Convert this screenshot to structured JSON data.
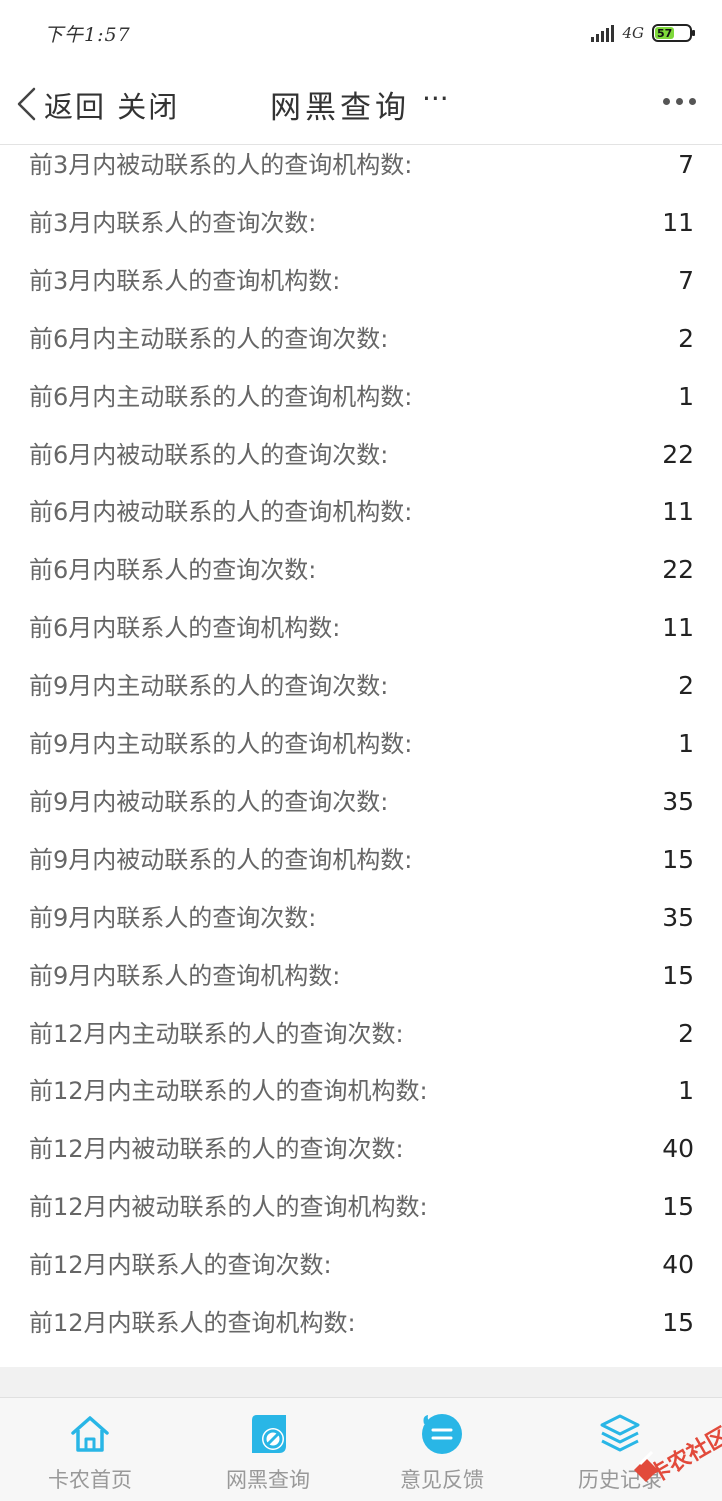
{
  "status_bar": {
    "time": "下午1:57",
    "network": "4G",
    "battery": "57"
  },
  "nav": {
    "back_label": "返回",
    "close_label": "关闭",
    "title": "网黑查询",
    "title_suffix": "···"
  },
  "rows": [
    {
      "label": "前3月内被动联系的人的查询机构数:",
      "value": "7"
    },
    {
      "label": "前3月内联系人的查询次数:",
      "value": "11"
    },
    {
      "label": "前3月内联系人的查询机构数:",
      "value": "7"
    },
    {
      "label": "前6月内主动联系的人的查询次数:",
      "value": "2"
    },
    {
      "label": "前6月内主动联系的人的查询机构数:",
      "value": "1"
    },
    {
      "label": "前6月内被动联系的人的查询次数:",
      "value": "22"
    },
    {
      "label": "前6月内被动联系的人的查询机构数:",
      "value": "11"
    },
    {
      "label": "前6月内联系人的查询次数:",
      "value": "22"
    },
    {
      "label": "前6月内联系人的查询机构数:",
      "value": "11"
    },
    {
      "label": "前9月内主动联系的人的查询次数:",
      "value": "2"
    },
    {
      "label": "前9月内主动联系的人的查询机构数:",
      "value": "1"
    },
    {
      "label": "前9月内被动联系的人的查询次数:",
      "value": "35"
    },
    {
      "label": "前9月内被动联系的人的查询机构数:",
      "value": "15"
    },
    {
      "label": "前9月内联系人的查询次数:",
      "value": "35"
    },
    {
      "label": "前9月内联系人的查询机构数:",
      "value": "15"
    },
    {
      "label": "前12月内主动联系的人的查询次数:",
      "value": "2"
    },
    {
      "label": "前12月内主动联系的人的查询机构数:",
      "value": "1"
    },
    {
      "label": "前12月内被动联系的人的查询次数:",
      "value": "40"
    },
    {
      "label": "前12月内被动联系的人的查询机构数:",
      "value": "15"
    },
    {
      "label": "前12月内联系人的查询次数:",
      "value": "40"
    },
    {
      "label": "前12月内联系人的查询机构数:",
      "value": "15"
    }
  ],
  "tabs": [
    {
      "label": "卡农首页",
      "icon": "home-icon"
    },
    {
      "label": "网黑查询",
      "icon": "query-icon"
    },
    {
      "label": "意见反馈",
      "icon": "feedback-icon"
    },
    {
      "label": "历史记录",
      "icon": "history-layers-icon"
    }
  ],
  "watermark": "卡农社区",
  "colors": {
    "accent": "#29b6e6",
    "label_text": "#666666",
    "value_text": "#222222",
    "tab_text": "#999999",
    "watermark": "#e24a3b"
  }
}
